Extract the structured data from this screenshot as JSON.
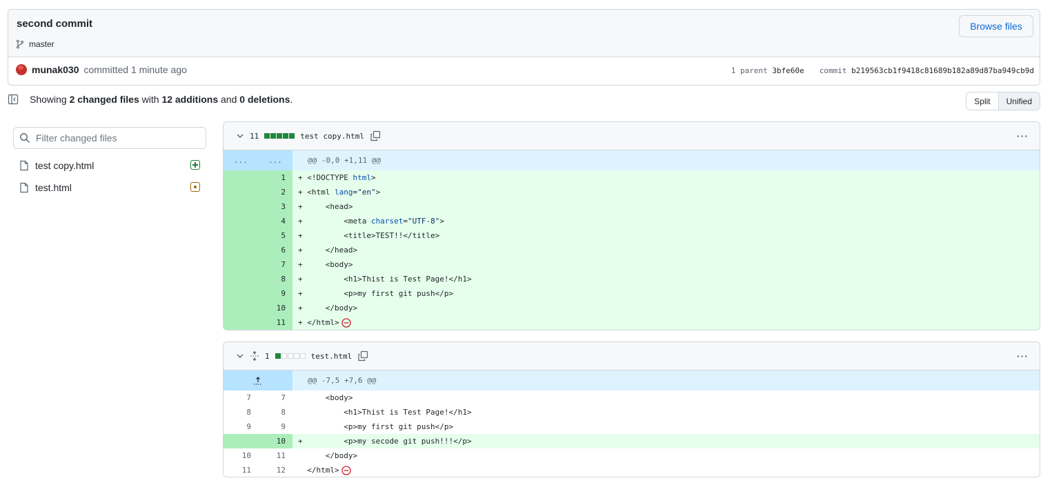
{
  "commit": {
    "title": "second commit",
    "branch": "master",
    "browse_label": "Browse files",
    "author": "munak030",
    "action": "committed 1 minute ago",
    "parent_label": "1 parent",
    "parent_hash": "3bfe60e",
    "commit_label": "commit",
    "commit_hash": "b219563cb1f9418c81689b182a89d87ba949cb9d"
  },
  "summary": {
    "prefix": "Showing",
    "files": "2 changed files",
    "with": "with",
    "additions": "12 additions",
    "and": "and",
    "deletions": "0 deletions",
    "suffix": "."
  },
  "view": {
    "split": "Split",
    "unified": "Unified",
    "selected": "Unified"
  },
  "filter": {
    "placeholder": "Filter changed files"
  },
  "tree": [
    {
      "name": "test copy.html",
      "status": "added"
    },
    {
      "name": "test.html",
      "status": "modified"
    }
  ],
  "diffs": [
    {
      "count": "11",
      "file": "test copy.html",
      "hunk": "@@ -0,0 +1,11 @@",
      "hunk_left": "...",
      "hunk_right": "..."
    },
    {
      "count": "1",
      "file": "test.html",
      "hunk": "@@ -7,5 +7,6 @@"
    }
  ],
  "colors": {
    "add_bg": "#e6ffec",
    "add_num_bg": "#aceebb",
    "hunk_bg": "#ddf4ff",
    "link": "#0969da",
    "green": "#1f883d"
  }
}
